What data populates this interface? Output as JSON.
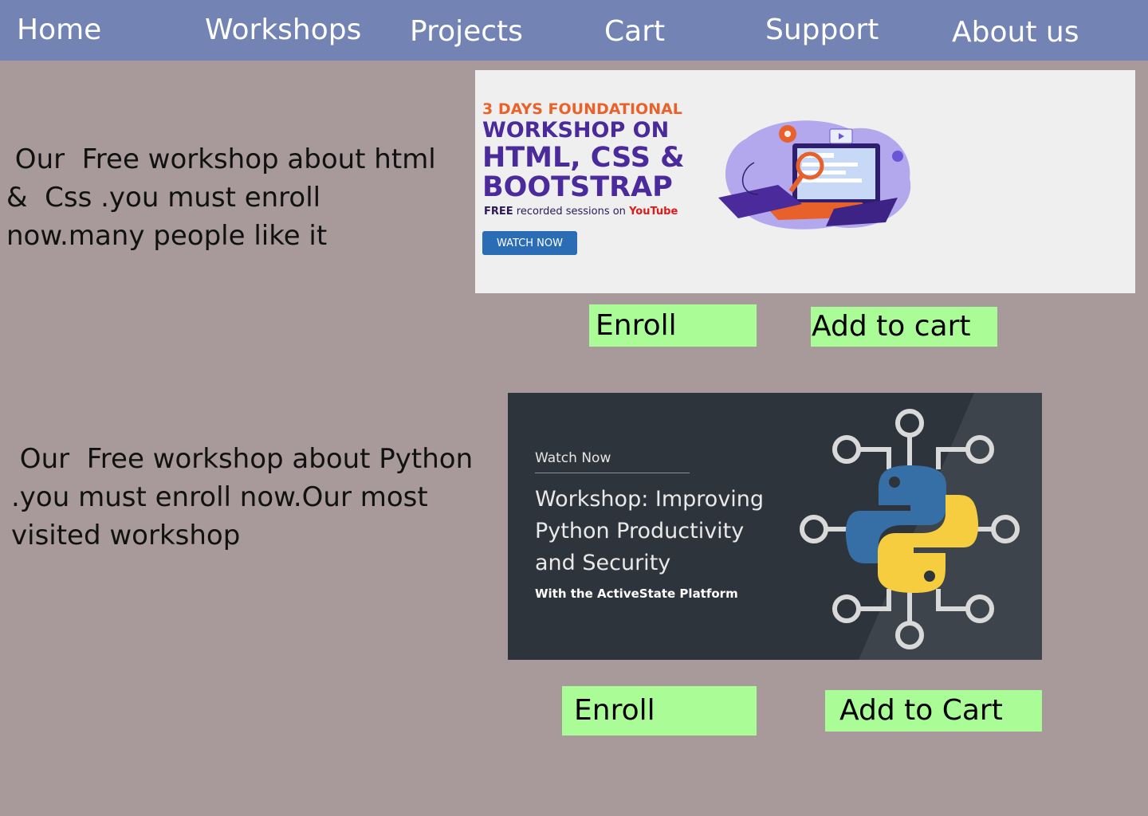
{
  "nav": {
    "items": [
      "Home",
      "Workshops",
      "Projects",
      "Cart",
      "Support",
      "About us"
    ]
  },
  "workshops": [
    {
      "description": " Our  Free workshop about html\n&  Css .you must enroll\nnow.many people like it",
      "banner": {
        "days": "3 DAYS FOUNDATIONAL",
        "line1": "WORKSHOP ON",
        "line2": "HTML, CSS &",
        "line3": "BOOTSTRAP",
        "free_bold": "FREE",
        "free_rest": " recorded sessions on ",
        "youtube": "YouTube",
        "watch": "WATCH NOW"
      },
      "enroll_label": "Enroll",
      "cart_label": "Add to cart"
    },
    {
      "description": " Our  Free workshop about Python\n.you must enroll now.Our most\nvisited workshop",
      "banner": {
        "watch": "Watch Now",
        "title": "Workshop: Improving\nPython Productivity\nand Security",
        "subtitle": "With the ActiveState Platform"
      },
      "enroll_label": "Enroll",
      "cart_label": "Add to Cart"
    }
  ],
  "colors": {
    "page_bg": "#a89a9a",
    "nav_bg": "#7384b4",
    "button_bg": "#a9fc96"
  }
}
